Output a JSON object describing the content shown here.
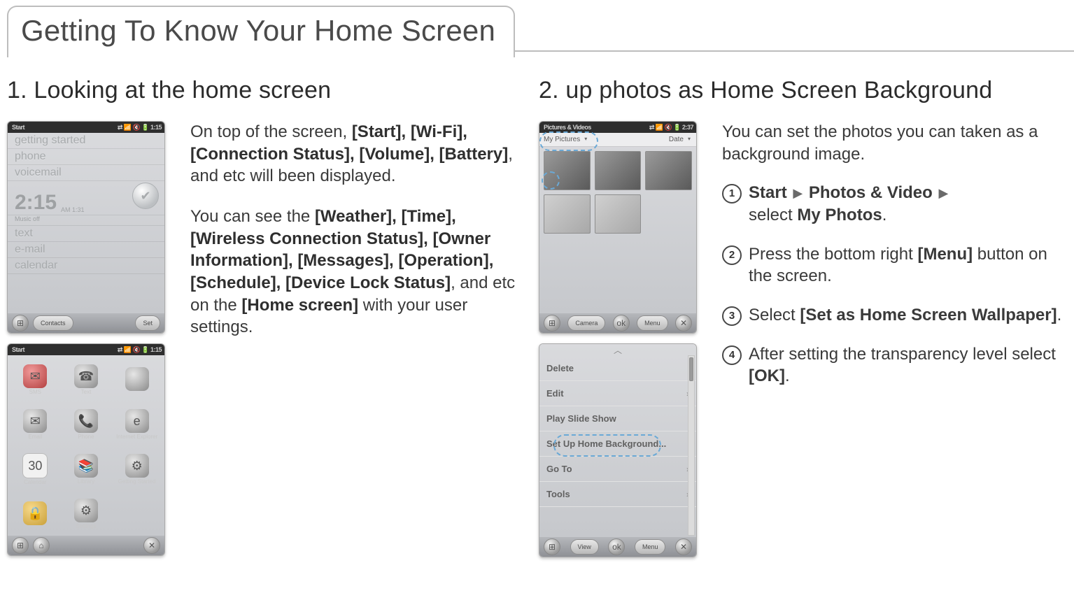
{
  "page_title": "Getting To Know Your Home Screen",
  "sections": {
    "s1": {
      "heading": "1. Looking at the home screen",
      "para1_pre": "On top of the screen, ",
      "para1_bold": "[Start], [Wi-Fi], [Connection Status], [Volume], [Battery]",
      "para1_post": ", and etc will been displayed.",
      "para2_pre": "You can see the ",
      "para2_bold1": "[Weather], [Time], [Wireless Connection Status], [Owner Information], [Messages], [Operation], [Schedule], [Device Lock Status]",
      "para2_mid": ", and etc on the ",
      "para2_bold2": "[Home screen]",
      "para2_post": " with your user settings."
    },
    "s2": {
      "heading": "2. up photos as Home Screen Background",
      "intro": "You can set the photos you can taken as a background image.",
      "step1_pre": "",
      "step1_bold1": "Start",
      "step1_sep": "▶",
      "step1_bold2": "Photos & Video",
      "step1_mid": "select ",
      "step1_bold3": "My Photos",
      "step1_post": ".",
      "step2_pre": "Press the bottom right ",
      "step2_bold": "[Menu]",
      "step2_post": " button on the screen.",
      "step3_pre": "Select ",
      "step3_bold": "[Set as Home Screen Wallpaper]",
      "step3_post": ".",
      "step4_pre": "After setting the transparency level select ",
      "step4_bold": "[OK]",
      "step4_post": "."
    }
  },
  "phone_home": {
    "topbar_left": "Start",
    "topbar_right": "⇄ 📶 🔇 🔋 1:15",
    "items": [
      "getting started",
      "phone",
      "voicemail"
    ],
    "time": "2:15",
    "time_meridiem": "AM\n1:31",
    "sub": "Music off",
    "items2": [
      "text",
      "e-mail",
      "calendar"
    ],
    "bottom_left_icon": "start-icon",
    "bottom_left_pill": "Contacts",
    "bottom_right_pill": "Set"
  },
  "phone_grid": {
    "topbar_left": "Start",
    "topbar_right": "⇄ 📶 🔇 🔋 1:15",
    "icons": [
      {
        "label": "SMS",
        "style": "red",
        "glyph": "✉"
      },
      {
        "label": "Text",
        "style": "gray",
        "glyph": "☎"
      },
      {
        "label": "",
        "style": "gray",
        "glyph": ""
      },
      {
        "label": "Email",
        "style": "gray",
        "glyph": "✉"
      },
      {
        "label": "Phone",
        "style": "gray",
        "glyph": "📞"
      },
      {
        "label": "Internet Explorer",
        "style": "gray",
        "glyph": "e"
      },
      {
        "label": "Calendar",
        "style": "white",
        "glyph": "30"
      },
      {
        "label": "Library",
        "style": "gray",
        "glyph": "📚"
      },
      {
        "label": "Getting Started",
        "style": "gray",
        "glyph": "⚙"
      },
      {
        "label": "",
        "style": "yellow",
        "glyph": "🔒"
      },
      {
        "label": "Settings",
        "style": "gray",
        "glyph": "⚙"
      },
      {
        "label": "",
        "style": "",
        "glyph": ""
      }
    ],
    "bottom_left": "start-icon",
    "bottom_center": "home-icon",
    "bottom_right": "close-icon"
  },
  "phone_photos": {
    "topbar_left": "Pictures & Videos",
    "topbar_right": "⇄ 📶 🔇 🔋 2:37",
    "dropdown": "My Pictures",
    "sort": "Date",
    "bottom_pills": [
      "Camera",
      "Menu"
    ],
    "bottom_left": "start-icon",
    "bottom_center": "ok-icon",
    "bottom_right": "close-icon"
  },
  "phone_menu": {
    "items": [
      {
        "label": "Delete",
        "chev": ""
      },
      {
        "label": "Edit",
        "chev": "›"
      },
      {
        "label": "Play Slide Show",
        "chev": ""
      },
      {
        "label": "Set Up Home Background...",
        "chev": ""
      },
      {
        "label": "Go To",
        "chev": "›"
      },
      {
        "label": "Tools",
        "chev": "›"
      }
    ],
    "bottom_pills": [
      "View",
      "Menu"
    ],
    "bottom_left": "start-icon",
    "bottom_center": "ok-icon",
    "bottom_right": "close-icon"
  }
}
